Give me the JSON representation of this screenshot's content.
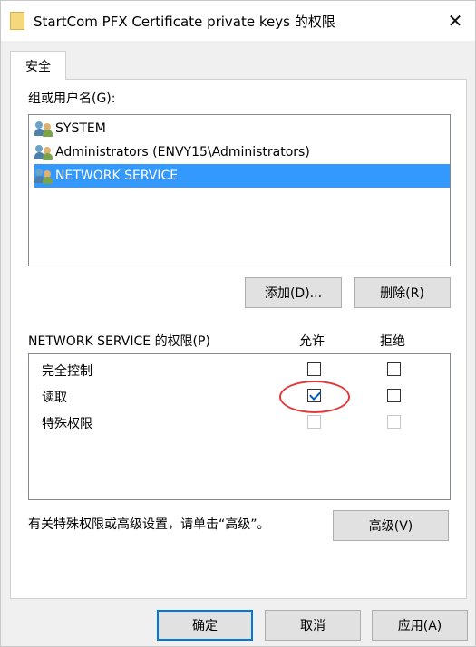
{
  "window": {
    "title": "StartCom PFX Certificate private keys 的权限",
    "close_symbol": "✕"
  },
  "tabs": [
    {
      "label": "安全"
    }
  ],
  "groups": {
    "label": "组或用户名(G):",
    "users": [
      {
        "name": "SYSTEM",
        "selected": false
      },
      {
        "name": "Administrators (ENVY15\\Administrators)",
        "selected": false
      },
      {
        "name": "NETWORK SERVICE",
        "selected": true
      }
    ]
  },
  "buttons": {
    "add": "添加(D)...",
    "remove": "删除(R)",
    "advanced": "高级(V)",
    "ok": "确定",
    "cancel": "取消",
    "apply": "应用(A)"
  },
  "permissions": {
    "label": "NETWORK SERVICE 的权限(P)",
    "allow_header": "允许",
    "deny_header": "拒绝",
    "rows": [
      {
        "name": "完全控制",
        "allow": false,
        "deny": false,
        "disabled": false
      },
      {
        "name": "读取",
        "allow": true,
        "deny": false,
        "disabled": false
      },
      {
        "name": "特殊权限",
        "allow": false,
        "deny": false,
        "disabled": true
      }
    ]
  },
  "advanced_note": "有关特殊权限或高级设置，请单击“高级”。",
  "colors": {
    "selection": "#3399ff",
    "highlight_circle": "#e23a3a",
    "default_button_border": "#0078d7"
  }
}
